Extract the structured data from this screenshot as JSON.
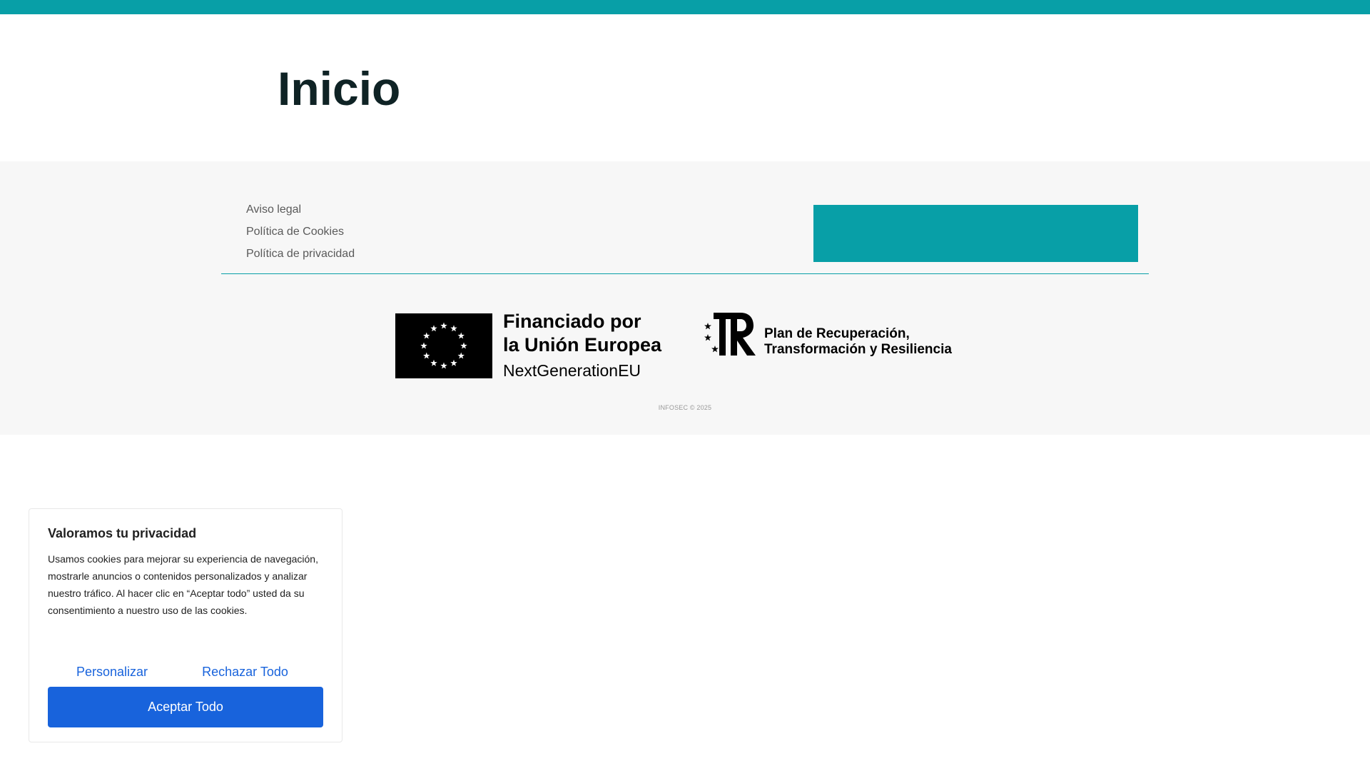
{
  "colors": {
    "brand_teal": "#089fa7",
    "cookie_accent": "#1863dc",
    "footer_bg": "#f7f7f7"
  },
  "page": {
    "title": "Inicio"
  },
  "footer": {
    "links": [
      {
        "label": "Aviso legal"
      },
      {
        "label": "Política de Cookies"
      },
      {
        "label": "Política de privacidad"
      }
    ],
    "eu_logo": {
      "line1": "Financiado por",
      "line2": "la Unión Europea",
      "line3": "NextGenerationEU"
    },
    "prtr_logo": {
      "line1": "Plan de Recuperación,",
      "line2": "Transformación y Resiliencia"
    },
    "copyright": "INFOSEC © 2025"
  },
  "cookie_banner": {
    "title": "Valoramos tu privacidad",
    "text": "Usamos cookies para mejorar su experiencia de navegación, mostrarle anuncios o contenidos personalizados y analizar nuestro tráfico. Al hacer clic en “Aceptar todo” usted da su consentimiento a nuestro uso de las cookies.",
    "customize_label": "Personalizar",
    "reject_label": "Rechazar Todo",
    "accept_label": "Aceptar Todo"
  }
}
